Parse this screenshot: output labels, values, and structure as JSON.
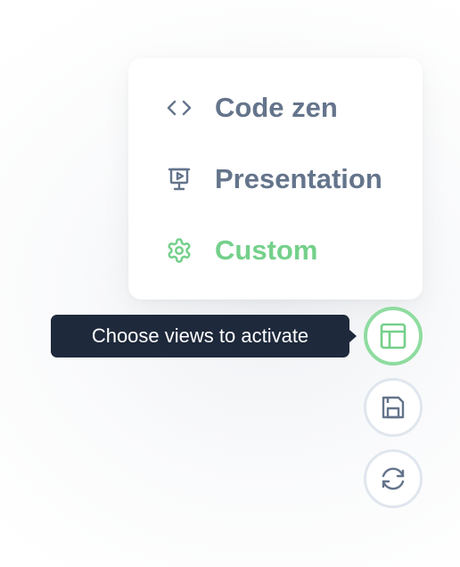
{
  "menu": {
    "items": [
      {
        "label": "Code zen",
        "icon": "code-icon",
        "active": false
      },
      {
        "label": "Presentation",
        "icon": "presentation-icon",
        "active": false
      },
      {
        "label": "Custom",
        "icon": "gear-icon",
        "active": true
      }
    ]
  },
  "tooltip": {
    "text": "Choose views to activate"
  },
  "buttons": [
    {
      "icon": "layout-icon",
      "active": true
    },
    {
      "icon": "save-icon",
      "active": false
    },
    {
      "icon": "refresh-icon",
      "active": false
    }
  ],
  "colors": {
    "muted": "#64748b",
    "accent": "#74d08a",
    "tooltip_bg": "#1e293b",
    "border": "#e0e6ee"
  }
}
